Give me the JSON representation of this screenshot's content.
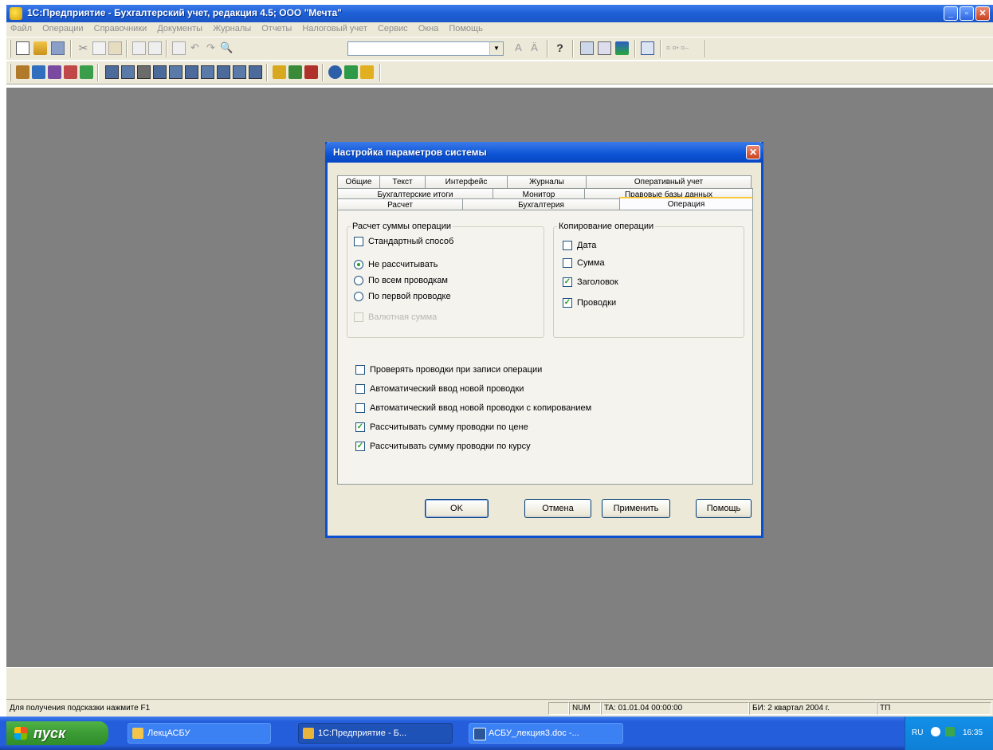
{
  "window": {
    "title": "1С:Предприятие - Бухгалтерский учет, редакция 4.5; ООО \"Мечта\""
  },
  "menu": {
    "items": [
      "Файл",
      "Операции",
      "Справочники",
      "Документы",
      "Журналы",
      "Отчеты",
      "Налоговый учет",
      "Сервис",
      "Окна",
      "Помощь"
    ]
  },
  "dialog": {
    "title": "Настройка параметров системы",
    "tabs_row1": [
      "Общие",
      "Текст",
      "Интерфейс",
      "Журналы",
      "Оперативный учет"
    ],
    "tabs_row2": [
      "Бухгалтерские итоги",
      "Монитор",
      "Правовые базы данных"
    ],
    "tabs_row3": [
      "Расчет",
      "Бухгалтерия",
      "Операция"
    ],
    "active_tab": "Операция",
    "calc_group": {
      "legend": "Расчет суммы операции",
      "standard_method": {
        "label": "Стандартный способ",
        "checked": false
      },
      "radios": [
        {
          "label": "Не рассчитывать",
          "selected": true
        },
        {
          "label": "По всем проводкам",
          "selected": false
        },
        {
          "label": "По первой проводке",
          "selected": false
        }
      ],
      "currency_sum": {
        "label": "Валютная сумма",
        "checked": false,
        "disabled": true
      }
    },
    "copy_group": {
      "legend": "Копирование операции",
      "items": [
        {
          "label": "Дата",
          "checked": false
        },
        {
          "label": "Сумма",
          "checked": false
        },
        {
          "label": "Заголовок",
          "checked": true
        },
        {
          "label": "Проводки",
          "checked": true
        }
      ]
    },
    "options": [
      {
        "label": "Проверять проводки при записи операции",
        "checked": false
      },
      {
        "label": "Автоматический ввод новой проводки",
        "checked": false
      },
      {
        "label": "Автоматический ввод новой проводки с копированием",
        "checked": false
      },
      {
        "label": "Рассчитывать сумму проводки по цене",
        "checked": true
      },
      {
        "label": "Рассчитывать сумму проводки по курсу",
        "checked": true
      }
    ],
    "buttons": {
      "ok": "OK",
      "cancel": "Отмена",
      "apply": "Применить",
      "help": "Помощь"
    }
  },
  "status_bar": {
    "hint": "Для получения подсказки нажмите F1",
    "num": "NUM",
    "ta": "TA: 01.01.04 00:00:00",
    "bi": "БИ: 2 квартал 2004 г.",
    "lang": "ТП"
  },
  "taskbar": {
    "start": "пуск",
    "tasks": [
      {
        "label": "ЛекцАСБУ"
      },
      {
        "label": "1С:Предприятие - Б..."
      },
      {
        "label": "АСБУ_лекция3.doc -..."
      }
    ],
    "tray": {
      "lang": "RU",
      "time": "16:35"
    }
  },
  "colors": {
    "titlebar": "#1d5fd6",
    "workspace": "#808080",
    "dialog_face": "#ece9d8",
    "taskbar": "#245edb",
    "start_button": "#3c9b34"
  }
}
